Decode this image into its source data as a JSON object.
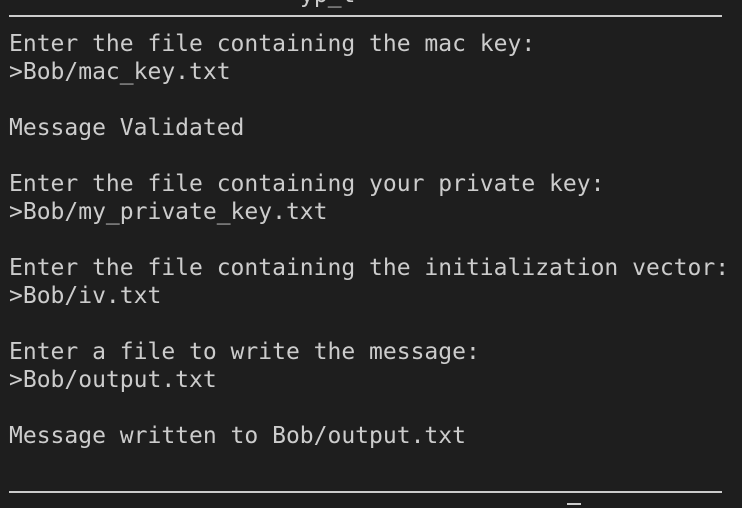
{
  "terminal": {
    "top_clipped_text": "yp_t",
    "lines": [
      "Enter the file containing the mac key:",
      ">Bob/mac_key.txt",
      "",
      "Message Validated",
      "",
      "Enter the file containing your private key:",
      ">Bob/my_private_key.txt",
      "",
      "Enter the file containing the initialization vector:",
      ">Bob/iv.txt",
      "",
      "Enter a file to write the message:",
      ">Bob/output.txt",
      "",
      "Message written to Bob/output.txt"
    ]
  }
}
